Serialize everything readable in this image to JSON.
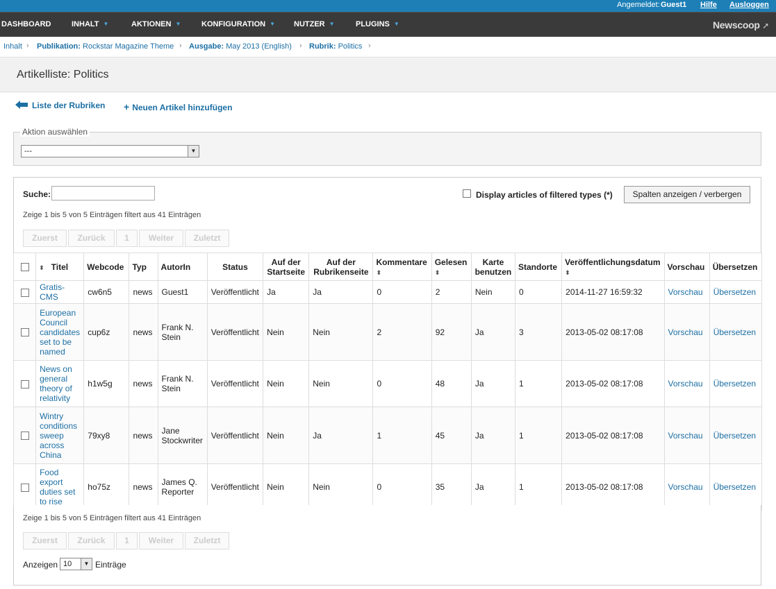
{
  "topbar": {
    "logged_in_label": "Angemeldet:",
    "user": "Guest1",
    "help": "Hilfe",
    "logout": "Ausloggen"
  },
  "nav": {
    "items": [
      "DASHBOARD",
      "INHALT",
      "AKTIONEN",
      "KONFIGURATION",
      "NUTZER",
      "PLUGINS"
    ],
    "logo": "Newscoop"
  },
  "breadcrumb": {
    "inhalt": "Inhalt",
    "pub_label": "Publikation:",
    "pub_value": "Rockstar Magazine Theme",
    "issue_label": "Ausgabe:",
    "issue_value": "May 2013 (English)",
    "section_label": "Rubrik:",
    "section_value": "Politics"
  },
  "page": {
    "title": "Artikelliste: Politics"
  },
  "actions": {
    "back": "Liste der Rubriken",
    "add": "Neuen Artikel hinzufügen"
  },
  "action_select": {
    "legend": "Aktion auswählen",
    "value": "---"
  },
  "filter": {
    "search_label": "Suche:",
    "search_value": "",
    "display_filtered": "Display articles of filtered types (*)",
    "columns_button": "Spalten anzeigen / verbergen",
    "info": "Zeige 1 bis 5 von 5 Einträgen filtert aus 41 Einträgen"
  },
  "pagination": {
    "first": "Zuerst",
    "prev": "Zurück",
    "page": "1",
    "next": "Weiter",
    "last": "Zuletzt"
  },
  "table": {
    "headers": {
      "title": "Titel",
      "webcode": "Webcode",
      "type": "Typ",
      "author": "AutorIn",
      "status": "Status",
      "frontpage": "Auf der Startseite",
      "sectionpage": "Auf der Rubrikenseite",
      "comments": "Kommentare",
      "reads": "Gelesen",
      "map": "Karte benutzen",
      "locations": "Standorte",
      "pubdate": "Veröffentlichungsdatum",
      "preview": "Vorschau",
      "translate": "Übersetzen"
    },
    "rows": [
      {
        "title": "Gratis-CMS",
        "webcode": "cw6n5",
        "type": "news",
        "author": "Guest1",
        "status": "Veröffentlicht",
        "frontpage": "Ja",
        "sectionpage": "Ja",
        "comments": "0",
        "reads": "2",
        "map": "Nein",
        "locations": "0",
        "pubdate": "2014-11-27 16:59:32",
        "preview": "Vorschau",
        "translate": "Übersetzen"
      },
      {
        "title": "European Council candidates set to be named",
        "webcode": "cup6z",
        "type": "news",
        "author": "Frank N. Stein",
        "status": "Veröffentlicht",
        "frontpage": "Nein",
        "sectionpage": "Nein",
        "comments": "2",
        "reads": "92",
        "map": "Ja",
        "locations": "3",
        "pubdate": "2013-05-02 08:17:08",
        "preview": "Vorschau",
        "translate": "Übersetzen"
      },
      {
        "title": "News on general theory of relativity",
        "webcode": "h1w5g",
        "type": "news",
        "author": "Frank N. Stein",
        "status": "Veröffentlicht",
        "frontpage": "Nein",
        "sectionpage": "Nein",
        "comments": "0",
        "reads": "48",
        "map": "Ja",
        "locations": "1",
        "pubdate": "2013-05-02 08:17:08",
        "preview": "Vorschau",
        "translate": "Übersetzen"
      },
      {
        "title": "Wintry conditions sweep across China",
        "webcode": "79xy8",
        "type": "news",
        "author": "Jane Stockwriter",
        "status": "Veröffentlicht",
        "frontpage": "Nein",
        "sectionpage": "Ja",
        "comments": "1",
        "reads": "45",
        "map": "Ja",
        "locations": "1",
        "pubdate": "2013-05-02 08:17:08",
        "preview": "Vorschau",
        "translate": "Übersetzen"
      },
      {
        "title": "Food export duties set to rise",
        "webcode": "ho75z",
        "type": "news",
        "author": "James Q. Reporter",
        "status": "Veröffentlicht",
        "frontpage": "Nein",
        "sectionpage": "Nein",
        "comments": "0",
        "reads": "35",
        "map": "Ja",
        "locations": "1",
        "pubdate": "2013-05-02 08:17:08",
        "preview": "Vorschau",
        "translate": "Übersetzen"
      }
    ]
  },
  "page_size": {
    "label": "Anzeigen",
    "value": "10",
    "suffix": "Einträge"
  }
}
